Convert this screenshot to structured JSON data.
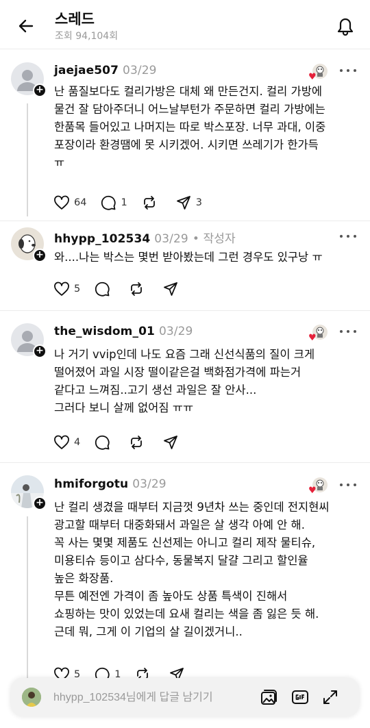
{
  "header": {
    "title": "스레드",
    "views": "조회 94,104회",
    "back_icon": "arrow-left-icon",
    "bell_icon": "bell-icon"
  },
  "posts": [
    {
      "username": "jaejae507",
      "date": "03/29",
      "label": "",
      "lines": [
        "난 품질보다도 컬리가방은 대체 왜 만든건지. 컬리 가방에",
        "물건 잘 담아주더니 어느날부턴가 주문하면 컬리 가방에는",
        "한품목 들어있고 나머지는 따로 박스포장. 너무 과대, 이중",
        "포장이라 환경땜에 못 시키겠어. 시키면 쓰레기가 한가득",
        "ㅠ"
      ],
      "likes": "64",
      "comments": "1",
      "reposts": "",
      "shares": "3"
    },
    {
      "username": "hhypp_102534",
      "date": "03/29",
      "label": "• 작성자",
      "lines": [
        "와....나는 박스는 몇번 받아봤는데 그런 경우도 있구낭 ㅠ"
      ],
      "likes": "5",
      "comments": "",
      "reposts": "",
      "shares": ""
    },
    {
      "username": "the_wisdom_01",
      "date": "03/29",
      "label": "",
      "lines": [
        "나 거기 vvip인데 나도 요즘 그래 신선식품의 질이 크게",
        "떨어졌어 과일 시장 떨이같은걸 백화점가격에 파는거",
        "같다고 느껴짐..고기 생선 과일은 잘 안사...",
        "그러다 보니 살께 없어짐 ㅠㅠ"
      ],
      "likes": "4",
      "comments": "",
      "reposts": "",
      "shares": ""
    },
    {
      "username": "hmiforgotu",
      "date": "03/29",
      "label": "",
      "lines": [
        "난 컬리 생겼을 때부터 지금껏 9년차 쓰는 중인데 전지현씨",
        "광고할 때부터 대중화돼서 과일은 살 생각 아예 안 해.",
        "꼭 사는 몇몇 제품도 신선제는 아니고 컬리 제작 물티슈,",
        "미용티슈 등이고 삼다수, 동물복지 달걀 그리고 할인율",
        "높은 화장품.",
        "무튼 예전엔 가격이 좀 높아도 상품 특색이 진해서",
        "쇼핑하는 맛이 있었는데 요새 컬리는 색을 좀 잃은 듯 해.",
        "근데 뭐, 그게 이 기업의 살 길이겠거니.."
      ],
      "likes": "5",
      "comments": "1",
      "reposts": "",
      "shares": ""
    }
  ],
  "reply_bar": {
    "placeholder": "hhypp_102534님에게 답글 남기기",
    "icons": [
      "image-icon",
      "gif-icon",
      "expand-icon"
    ]
  },
  "colors": {
    "text": "#101010",
    "muted": "#999999",
    "heart": "#e5213a",
    "divider": "#ececec"
  }
}
